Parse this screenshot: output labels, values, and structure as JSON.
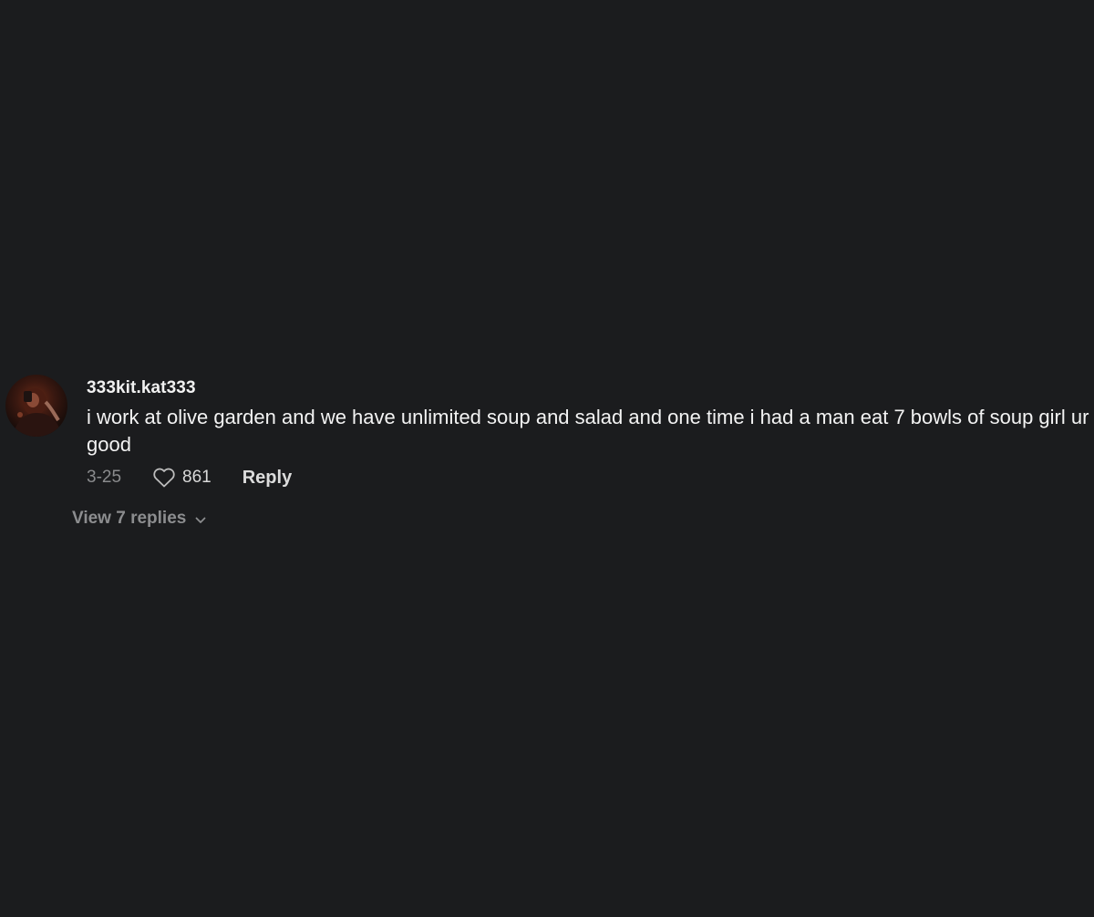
{
  "comment": {
    "username": "333kit.kat333",
    "text": "i work at olive garden and we have unlimited soup and salad and one time i had a man eat 7 bowls of soup girl ur good",
    "date": "3-25",
    "like_count": "861",
    "reply_label": "Reply",
    "view_replies_label": "View 7 replies",
    "avatar_icon": "user-avatar",
    "like_icon": "heart-outline-icon",
    "expand_icon": "chevron-down-icon"
  },
  "colors": {
    "background": "#1b1c1e",
    "primary_text": "#f3f3f3",
    "secondary_text": "#8a8b8d"
  }
}
